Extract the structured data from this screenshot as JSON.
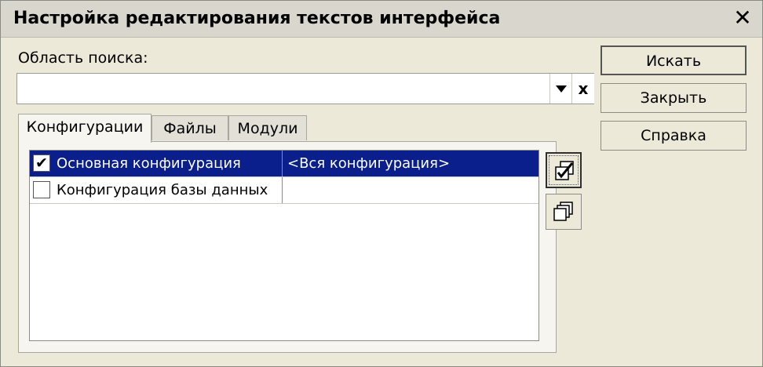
{
  "window": {
    "title": "Настройка редактирования текстов интерфейса",
    "close_icon": "close-icon"
  },
  "search": {
    "label": "Область поиска:",
    "value": "",
    "clear_label": "x"
  },
  "tabs": [
    {
      "label": "Конфигурации",
      "active": true
    },
    {
      "label": "Файлы",
      "active": false
    },
    {
      "label": "Модули",
      "active": false
    }
  ],
  "grid": {
    "rows": [
      {
        "checked": true,
        "name": "Основная конфигурация",
        "value": "<Вся конфигурация>",
        "selected": true
      },
      {
        "checked": false,
        "name": "Конфигурация базы данных",
        "value": "",
        "selected": false
      }
    ]
  },
  "side_tools": [
    {
      "icon": "check-all-icon",
      "active": true
    },
    {
      "icon": "uncheck-all-icon",
      "active": false
    }
  ],
  "buttons": {
    "search": "Искать",
    "close": "Закрыть",
    "help": "Справка"
  },
  "colors": {
    "selection": "#0a1f8c",
    "window_bg": "#ece9d8"
  }
}
